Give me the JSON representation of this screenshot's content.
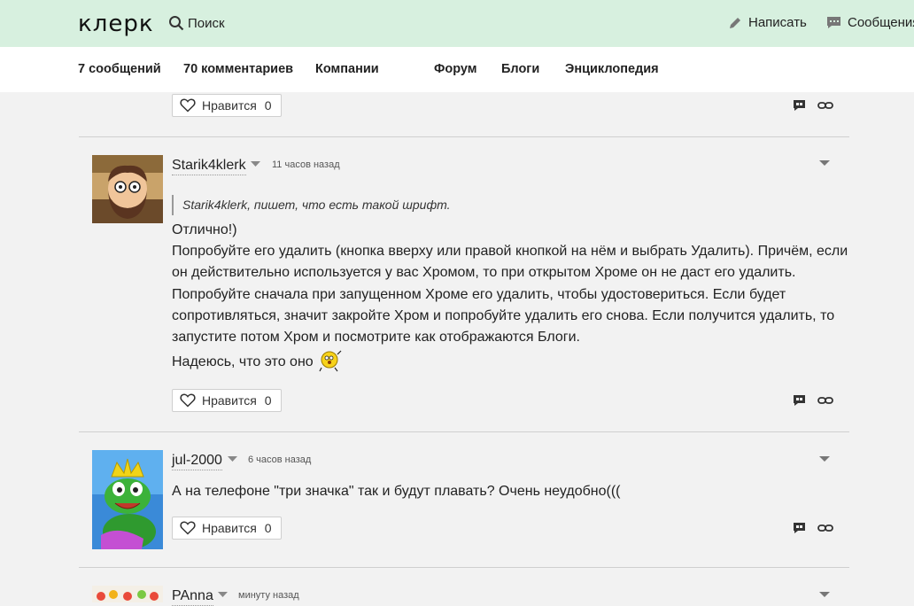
{
  "header": {
    "logo": "клерк",
    "search_label": "Поиск",
    "write_label": "Написать",
    "messages_label": "Сообщения"
  },
  "nav": {
    "items": [
      "7 сообщений",
      "70 комментариев",
      "Компании",
      "Форум",
      "Блоги",
      "Энциклопедия"
    ]
  },
  "like_label": "Нравится",
  "comments": [
    {
      "like_count": "0"
    },
    {
      "author": "Starik4klerk",
      "time": "11 часов назад",
      "quote": "Starik4klerk, пишет, что есть такой шрифт.",
      "lines": [
        "Отлично!)",
        "Попробуйте его удалить (кнопка вверху или правой кнопкой на нём и выбрать Удалить). Причём, если он действительно используется у вас Хромом, то при открытом Хроме он не даст его удалить. Попробуйте сначала при запущенном Хроме его удалить, чтобы удостовериться. Если будет сопротивляться, значит закройте Хром и попробуйте удалить его снова. Если получится удалить, то запустите потом Хром и посмотрите как отображаются Блоги.",
        "Надеюсь, что это оно"
      ],
      "like_count": "0"
    },
    {
      "author": "jul-2000",
      "time": "6 часов назад",
      "lines": [
        "А на телефоне \"три значка\" так и будут плавать? Очень неудобно((("
      ],
      "like_count": "0"
    },
    {
      "author": "PAnna",
      "time": "минуту назад"
    }
  ],
  "icons": {
    "search": "search-icon",
    "write": "pencil-icon",
    "messages": "chat-icon",
    "like": "heart-icon",
    "reply": "reply-icon",
    "link": "link-icon",
    "caret": "chevron-down-icon"
  }
}
